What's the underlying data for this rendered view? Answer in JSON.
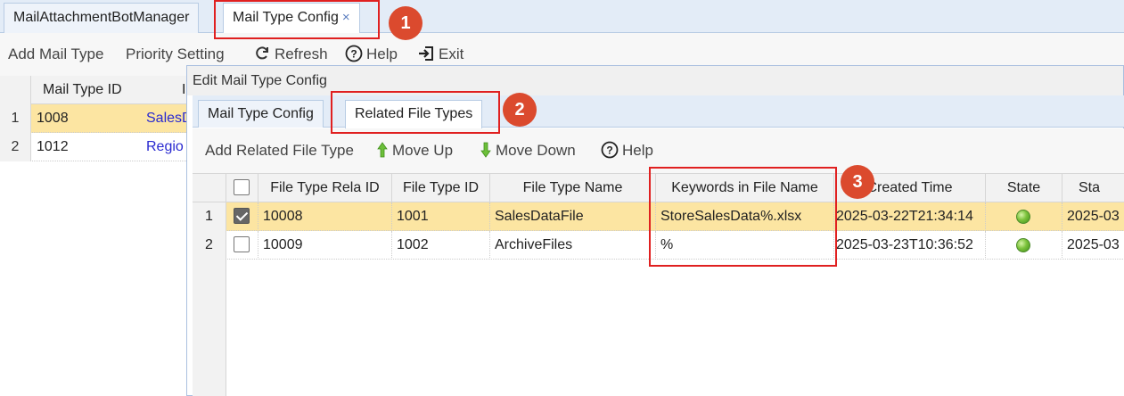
{
  "top_tabs": [
    {
      "label": "MailAttachmentBotManager"
    },
    {
      "label": "Mail Type Config",
      "close": "×"
    }
  ],
  "toolbar": {
    "add_mail_type": "Add Mail Type",
    "priority_setting": "Priority Setting",
    "refresh": "Refresh",
    "help": "Help",
    "exit": "Exit"
  },
  "mail_type_grid": {
    "headers": {
      "mail_type_id": "Mail Type ID",
      "name_partial": "I"
    },
    "rows": [
      {
        "num": "1",
        "id": "1008",
        "name": "SalesD"
      },
      {
        "num": "2",
        "id": "1012",
        "name": "Regio"
      }
    ]
  },
  "dialog": {
    "title": "Edit Mail Type Config",
    "tabs": [
      {
        "label": "Mail Type Config"
      },
      {
        "label": "Related File Types"
      }
    ],
    "toolbar": {
      "add": "Add Related File Type",
      "move_up": "Move Up",
      "move_down": "Move Down",
      "help": "Help"
    },
    "grid": {
      "headers": {
        "rela_id": "File Type Rela ID",
        "type_id": "File Type ID",
        "type_name": "File Type Name",
        "keywords": "Keywords in File Name",
        "created": "Created Time",
        "state": "State",
        "state_time": "Sta"
      },
      "rows": [
        {
          "num": "1",
          "checked": true,
          "rela_id": "10008",
          "type_id": "1001",
          "type_name": "SalesDataFile",
          "keywords": "StoreSalesData%.xlsx",
          "created": "2025-03-22T21:34:14",
          "state_time": "2025-03"
        },
        {
          "num": "2",
          "checked": false,
          "rela_id": "10009",
          "type_id": "1002",
          "type_name": "ArchiveFiles",
          "keywords": "%",
          "created": "2025-03-23T10:36:52",
          "state_time": "2025-03"
        }
      ]
    }
  },
  "annotations": {
    "badge1": "1",
    "badge2": "2",
    "badge3": "3"
  },
  "colors": {
    "selected_row": "#fce5a2",
    "annotation_red": "#e02020",
    "badge": "#db4a2e",
    "state_active": "#7cc23c"
  }
}
